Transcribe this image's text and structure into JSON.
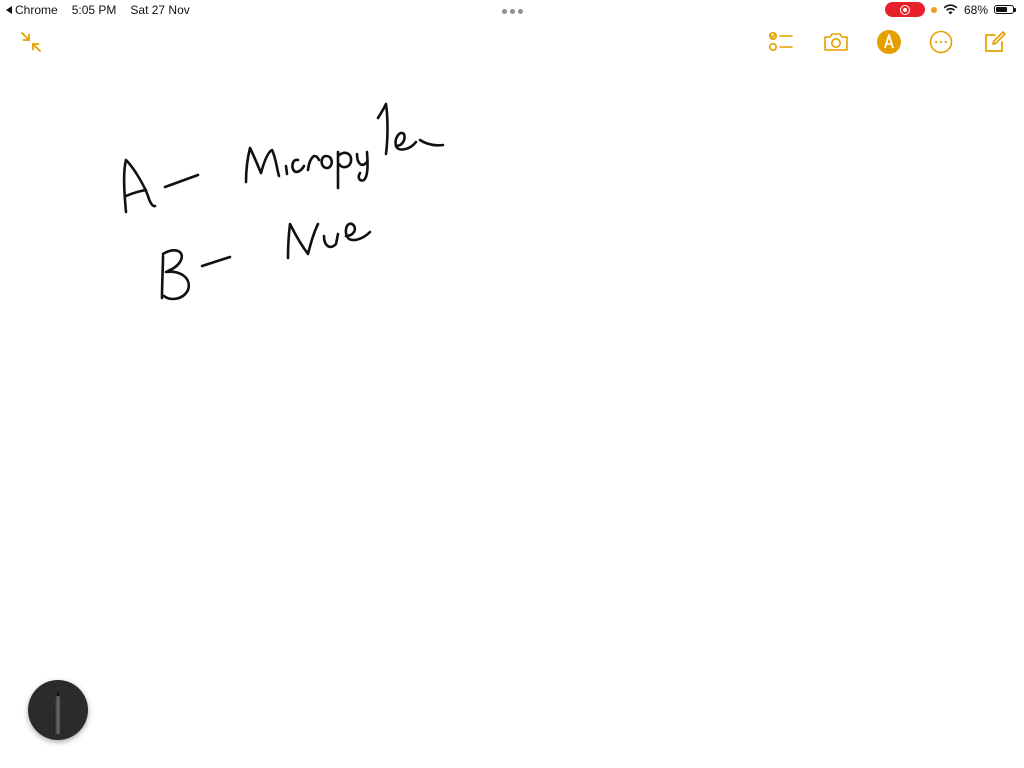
{
  "status_bar": {
    "back_app": "Chrome",
    "time": "5:05 PM",
    "date": "Sat 27 Nov",
    "battery_percent": "68%",
    "battery_level": 0.68
  },
  "toolbar": {
    "accent_color": "#e5a000",
    "icons": [
      "collapse-icon",
      "checklist-icon",
      "camera-icon",
      "markup-icon",
      "more-icon",
      "compose-icon"
    ]
  },
  "note": {
    "handwriting": [
      "A- Micropyle",
      "B- Nue"
    ]
  },
  "pen_tool": {
    "icon": "pen-icon"
  }
}
